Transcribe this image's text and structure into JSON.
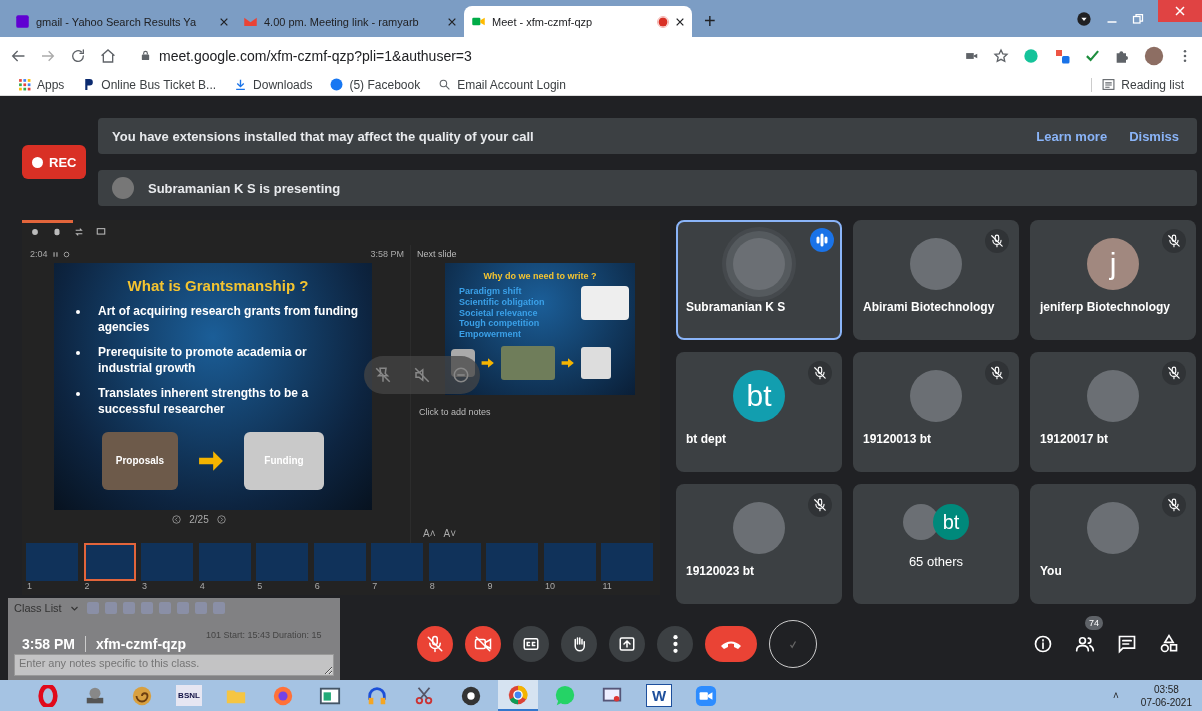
{
  "browser": {
    "tabs": [
      {
        "title": "gmail - Yahoo Search Results Ya",
        "kind": "yahoo",
        "selected": false,
        "recording": false
      },
      {
        "title": "4.00 pm. Meeting link - ramyarb",
        "kind": "gmail",
        "selected": false,
        "recording": false
      },
      {
        "title": "Meet - xfm-czmf-qzp",
        "kind": "meet",
        "selected": true,
        "recording": true
      }
    ],
    "new_tab": "+",
    "url": "meet.google.com/xfm-czmf-qzp?pli=1&authuser=3",
    "bookmarks": [
      {
        "label": "Apps",
        "kind": "apps"
      },
      {
        "label": "Online Bus Ticket B...",
        "kind": "favicon"
      },
      {
        "label": "Downloads",
        "kind": "download"
      },
      {
        "label": "(5) Facebook",
        "kind": "facebook"
      },
      {
        "label": "Email Account Login",
        "kind": "search"
      }
    ],
    "reading_list": "Reading list"
  },
  "meet": {
    "extension_banner": {
      "message": "You have extensions installed that may affect the quality of your call",
      "actions": [
        "Learn more",
        "Dismiss"
      ]
    },
    "rec": "REC",
    "presenting": "Subramanian K S is presenting",
    "presenter_view": {
      "progress": {
        "level": 0.08
      },
      "timer": "2:04",
      "clock": "3:58 PM",
      "next_label": "Next slide",
      "slide": {
        "title": "What is Grantsmanship ?",
        "bullets": [
          "Art of **acquiring** research grants from funding agencies",
          "Prerequisite to **promote** academia or industrial growth",
          "Translates inherent strengths to be a **successful** researcher"
        ],
        "images": [
          "Proposals",
          "Funding"
        ]
      },
      "next_slide": {
        "title": "Why do we need to write ?",
        "items": [
          "Paradigm shift",
          "Scientific obligation",
          "Societal relevance",
          "Tough competition",
          "Empowerment"
        ]
      },
      "notes": "Click to add notes",
      "counter": "2/25",
      "font_controls": [
        "A˄",
        "A˅"
      ],
      "thumbnails": [
        {
          "number": "1",
          "selected": false
        },
        {
          "number": "2",
          "selected": true
        },
        {
          "number": "3",
          "selected": false
        },
        {
          "number": "4",
          "selected": false
        },
        {
          "number": "5",
          "selected": false
        },
        {
          "number": "6",
          "selected": false
        },
        {
          "number": "7",
          "selected": false
        },
        {
          "number": "8",
          "selected": false
        },
        {
          "number": "9",
          "selected": false
        },
        {
          "number": "10",
          "selected": false
        },
        {
          "number": "11",
          "selected": false
        }
      ]
    },
    "tiles": [
      {
        "name": "Subramanian K S",
        "avatar": {
          "kind": "photo"
        },
        "muted": false,
        "speaking": true,
        "selected": true
      },
      {
        "name": "Abirami Biotechnology",
        "avatar": {
          "kind": "photo"
        },
        "muted": true,
        "speaking": false,
        "selected": false
      },
      {
        "name": "jeniferp Biotechnology",
        "avatar": {
          "kind": "letter",
          "letter": "j",
          "color": "#a1887f"
        },
        "muted": true,
        "speaking": false,
        "selected": false
      },
      {
        "name": "bt dept",
        "avatar": {
          "kind": "letter",
          "letter": "bt",
          "color": "#129eaf"
        },
        "muted": true,
        "speaking": false,
        "selected": false
      },
      {
        "name": "19120013 bt",
        "avatar": {
          "kind": "photo"
        },
        "muted": true,
        "speaking": false,
        "selected": false
      },
      {
        "name": "19120017 bt",
        "avatar": {
          "kind": "photo"
        },
        "muted": true,
        "speaking": false,
        "selected": false
      },
      {
        "name": "19120023 bt",
        "avatar": {
          "kind": "photo"
        },
        "muted": true,
        "speaking": false,
        "selected": false
      },
      {
        "name": "65 others",
        "avatar": {
          "kind": "others",
          "letter": "bt",
          "color": "#00897b"
        },
        "muted": false,
        "speaking": false,
        "selected": false
      },
      {
        "name": "You",
        "avatar": {
          "kind": "photo"
        },
        "muted": true,
        "speaking": false,
        "selected": false
      }
    ],
    "meeting_bar": {
      "time": "3:58 PM",
      "code": "xfm-czmf-qzp",
      "controls": [
        {
          "kind": "mic",
          "off": true
        },
        {
          "kind": "camera",
          "off": true
        },
        {
          "kind": "captions",
          "off": false
        },
        {
          "kind": "hand",
          "off": false
        },
        {
          "kind": "present",
          "off": false
        },
        {
          "kind": "more",
          "off": false
        },
        {
          "kind": "end"
        },
        {
          "kind": "ring"
        }
      ],
      "side": [
        {
          "kind": "info"
        },
        {
          "kind": "people",
          "badge": "74"
        },
        {
          "kind": "chat"
        },
        {
          "kind": "activities"
        }
      ]
    },
    "class_list": {
      "title": "Class List",
      "info": "101 Start: 15:43 Duration: 15",
      "notes_placeholder": "Enter any notes specific to this class."
    }
  },
  "taskbar": {
    "apps": [
      {
        "kind": "o",
        "selected": false
      },
      {
        "kind": "gear",
        "selected": false
      },
      {
        "kind": "shell",
        "selected": false
      },
      {
        "kind": "label",
        "label": "BSNL",
        "selected": false
      },
      {
        "kind": "folder",
        "selected": false
      },
      {
        "kind": "fox",
        "selected": false
      },
      {
        "kind": "window",
        "selected": false
      },
      {
        "kind": "headphones",
        "selected": false
      },
      {
        "kind": "scissors",
        "selected": false
      },
      {
        "kind": "disc",
        "selected": false
      },
      {
        "kind": "chrome",
        "selected": true
      },
      {
        "kind": "phone",
        "selected": false
      },
      {
        "kind": "monitor",
        "selected": false
      },
      {
        "kind": "letter",
        "label": "W",
        "selected": false
      },
      {
        "kind": "video",
        "selected": false
      }
    ],
    "tray": "˄",
    "time": "03:58",
    "date": "07-06-2021"
  }
}
